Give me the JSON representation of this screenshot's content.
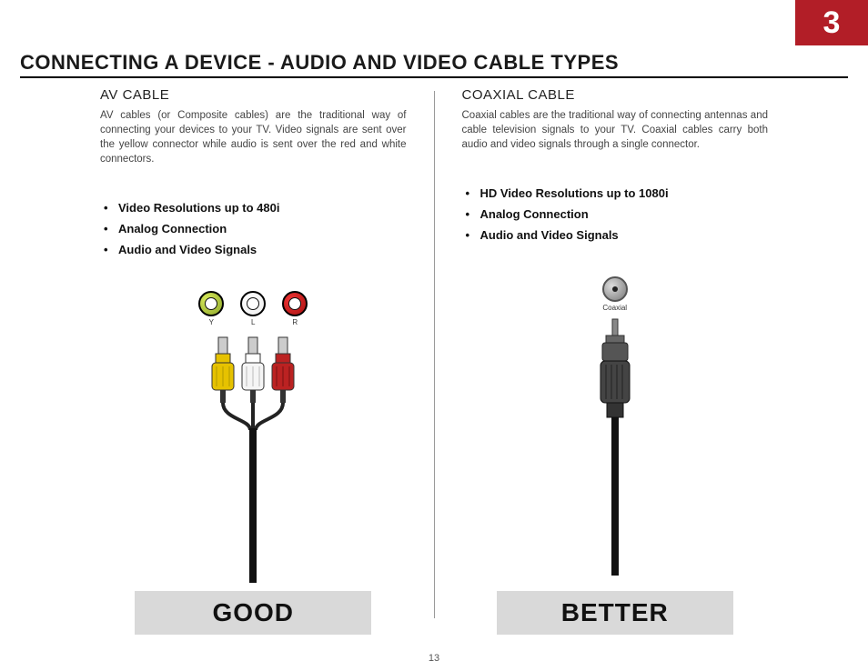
{
  "chapter_number": "3",
  "page_title": "CONNECTING A DEVICE - AUDIO AND VIDEO CABLE TYPES",
  "page_number": "13",
  "left": {
    "heading": "AV CABLE",
    "desc": "AV cables (or Composite cables) are the traditional way of connecting your devices to your TV. Video signals are sent over the yellow connector while audio is sent over the red and white connectors.",
    "bullets": [
      "Video Resolutions up to 480i",
      "Analog Connection",
      "Audio and Video Signals"
    ],
    "jack_labels": {
      "y": "Y",
      "l": "L",
      "r": "R"
    },
    "rating": "GOOD"
  },
  "right": {
    "heading": "COAXIAL CABLE",
    "desc": "Coaxial cables are the traditional way of connecting antennas and cable television signals to your TV. Coaxial cables carry both audio and video signals through a single connector.",
    "bullets": [
      "HD Video Resolutions up to 1080i",
      "Analog Connection",
      "Audio and Video Signals"
    ],
    "jack_label": "Coaxial",
    "rating": "BETTER"
  }
}
